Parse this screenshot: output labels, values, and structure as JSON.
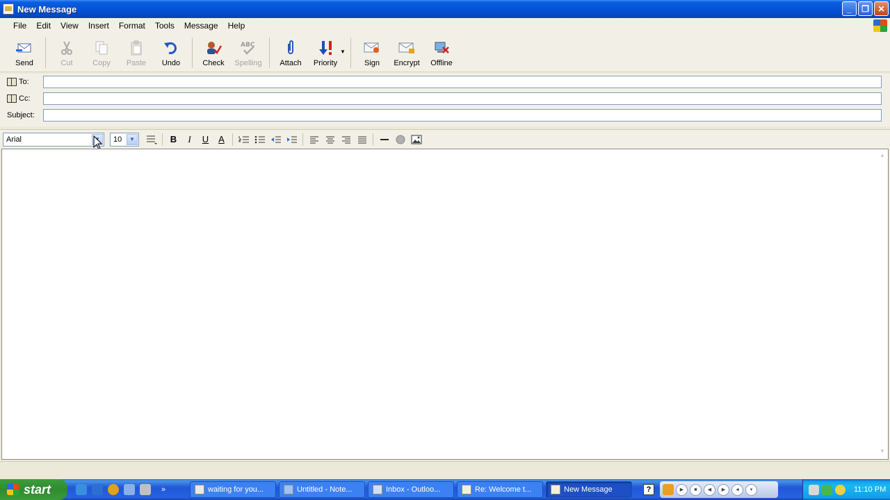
{
  "window": {
    "title": "New Message"
  },
  "menu": [
    "File",
    "Edit",
    "View",
    "Insert",
    "Format",
    "Tools",
    "Message",
    "Help"
  ],
  "toolbar": {
    "send": "Send",
    "cut": "Cut",
    "copy": "Copy",
    "paste": "Paste",
    "undo": "Undo",
    "check": "Check",
    "spelling": "Spelling",
    "spelling_glyph": "ABC",
    "attach": "Attach",
    "priority": "Priority",
    "sign": "Sign",
    "encrypt": "Encrypt",
    "offline": "Offline"
  },
  "fields": {
    "to_label": "To:",
    "to_value": "",
    "cc_label": "Cc:",
    "cc_value": "",
    "subject_label": "Subject:",
    "subject_value": ""
  },
  "format": {
    "font": "Arial",
    "size": "10",
    "bold": "B",
    "italic": "I",
    "underline": "U",
    "font_color": "A"
  },
  "body": {
    "text": ""
  },
  "taskbar": {
    "start": "start",
    "tasks": [
      "waiting for you...",
      "Untitled - Note...",
      "Inbox - Outloo...",
      "Re: Welcome t...",
      "New Message"
    ],
    "help": "?",
    "clock": "11:10 PM"
  },
  "colors": {
    "titlebar": "#0453d6",
    "taskbar": "#2157d7",
    "start": "#2f8b2f",
    "tray": "#139ee9"
  }
}
